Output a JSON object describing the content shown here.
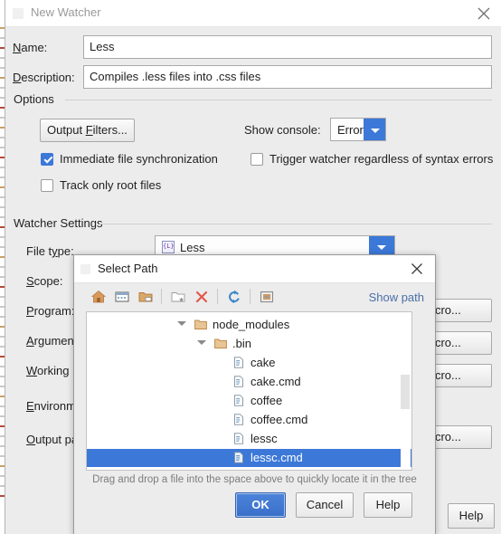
{
  "main_window": {
    "title": "New Watcher",
    "close_icon": "close-icon",
    "fields": [
      {
        "label_pre": "N",
        "label_mnemonic": "",
        "label": "Name:",
        "value": "Less"
      },
      {
        "label": "Description:",
        "value": "Compiles .less files into .css files"
      }
    ],
    "name_label": "Name:",
    "name_value": "Less",
    "description_label": "Description:",
    "description_value": "Compiles .less files into .css files",
    "options_group": "Options",
    "output_filters_button": "Output Filters...",
    "show_console_label": "Show console:",
    "show_console_value": "Error",
    "checkboxes": [
      {
        "label": "Immediate file synchronization",
        "checked": true
      },
      {
        "label": "Trigger watcher regardless of syntax errors",
        "checked": false
      },
      {
        "label": "Track only root files",
        "checked": false
      }
    ],
    "watcher_settings_group": "Watcher Settings",
    "settings_labels": [
      "File type:",
      "Scope:",
      "Program:",
      "Argumen",
      "Working",
      "Environm",
      "Output pa"
    ],
    "file_type_value": "Less",
    "file_type_icon": "less-file-icon",
    "insert_macro_button": "ert macro...",
    "insert_macro_count": 4,
    "help_button": "Help"
  },
  "select_path_dialog": {
    "title": "Select Path",
    "close_icon": "close-icon",
    "toolbar": [
      {
        "name": "home-icon",
        "tooltip": "Home"
      },
      {
        "name": "desktop-icon",
        "tooltip": "Desktop"
      },
      {
        "name": "project-folder-icon",
        "tooltip": "Project"
      },
      {
        "name": "new-folder-icon",
        "tooltip": "New Folder",
        "disabled": true
      },
      {
        "name": "delete-icon",
        "tooltip": "Delete"
      },
      {
        "name": "refresh-icon",
        "tooltip": "Refresh"
      },
      {
        "name": "show-hidden-icon",
        "tooltip": "Show hidden files and directories"
      }
    ],
    "show_path_link": "Show path",
    "tree": [
      {
        "name": "node_modules",
        "type": "folder",
        "depth": 2,
        "expanded": true,
        "selected": false
      },
      {
        "name": ".bin",
        "type": "folder",
        "depth": 3,
        "expanded": true,
        "selected": false
      },
      {
        "name": "cake",
        "type": "file",
        "depth": 4,
        "selected": false
      },
      {
        "name": "cake.cmd",
        "type": "file",
        "depth": 4,
        "selected": false
      },
      {
        "name": "coffee",
        "type": "file",
        "depth": 4,
        "selected": false
      },
      {
        "name": "coffee.cmd",
        "type": "file",
        "depth": 4,
        "selected": false
      },
      {
        "name": "lessc",
        "type": "file",
        "depth": 4,
        "selected": false
      },
      {
        "name": "lessc.cmd",
        "type": "file",
        "depth": 4,
        "selected": true
      }
    ],
    "hint": "Drag and drop a file into the space above to quickly locate it in the tree",
    "buttons": {
      "ok": "OK",
      "cancel": "Cancel",
      "help": "Help"
    }
  },
  "colors": {
    "accent": "#3c78d8",
    "selection": "#3c78d8",
    "dialog_bg": "#ececec",
    "field_bg": "#ffffff",
    "link": "#4a6fa8",
    "folder": "#c99a5b"
  }
}
